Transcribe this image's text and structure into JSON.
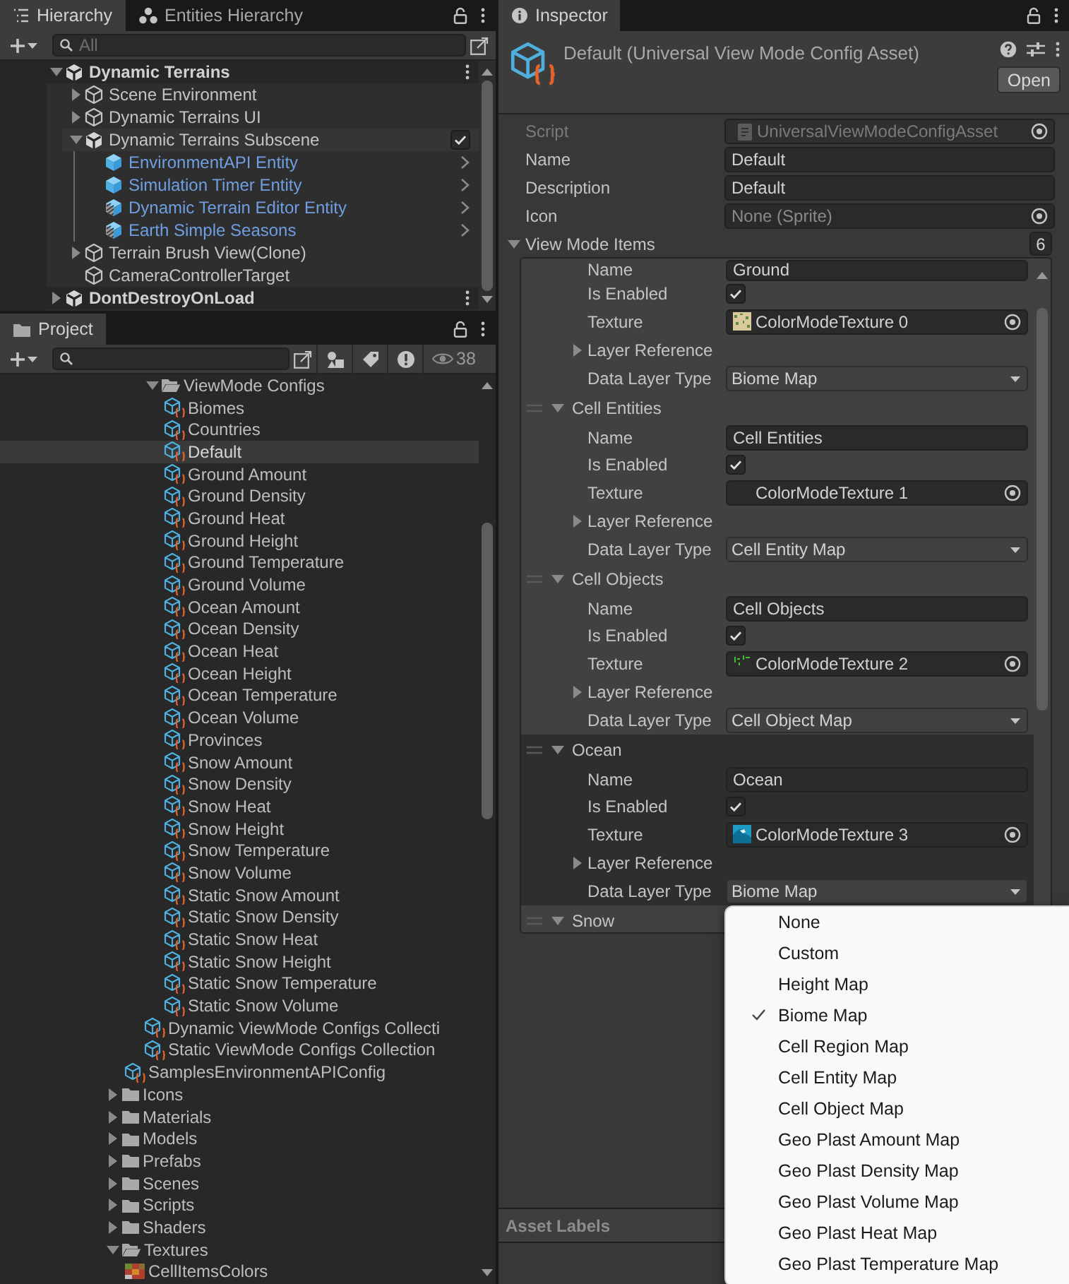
{
  "hierarchy": {
    "tabs": [
      {
        "label": "Hierarchy",
        "kind": "list",
        "selected": true
      },
      {
        "label": "Entities Hierarchy",
        "kind": "entities",
        "selected": false
      }
    ],
    "search": {
      "placeholder": "All"
    },
    "tree": [
      {
        "label": "Dynamic Terrains",
        "kind": "scene",
        "expanded": true,
        "children": [
          {
            "label": "Scene Environment",
            "kind": "object",
            "expanded": false
          },
          {
            "label": "Dynamic Terrains UI",
            "kind": "object",
            "expanded": false
          },
          {
            "label": "Dynamic Terrains Subscene",
            "kind": "subscene",
            "expanded": true,
            "checked": true,
            "children": [
              {
                "label": "EnvironmentAPI Entity",
                "kind": "entity"
              },
              {
                "label": "Simulation Timer Entity",
                "kind": "entity"
              },
              {
                "label": "Dynamic Terrain Editor Entity",
                "kind": "entity-mixed"
              },
              {
                "label": "Earth Simple Seasons",
                "kind": "entity-mixed"
              }
            ]
          },
          {
            "label": "Terrain Brush View(Clone)",
            "kind": "object",
            "expanded": false
          },
          {
            "label": "CameraControllerTarget",
            "kind": "leaf"
          }
        ]
      },
      {
        "label": "DontDestroyOnLoad",
        "kind": "scene",
        "expanded": false
      }
    ]
  },
  "project": {
    "tabs": [
      {
        "label": "Project",
        "kind": "folder",
        "selected": true
      }
    ],
    "hidden_count": "38",
    "tree": {
      "above": {
        "above": {
          "items": [
            {
              "label": "ViewMode Configs",
              "kind": "folder",
              "expanded": true,
              "selected": false,
              "children": [
                {
                  "label": "Biomes",
                  "kind": "config",
                  "selected": false
                },
                {
                  "label": "Countries",
                  "kind": "config",
                  "selected": false
                },
                {
                  "label": "Default",
                  "kind": "config",
                  "selected": true
                },
                {
                  "label": "Ground Amount",
                  "kind": "config",
                  "selected": false
                },
                {
                  "label": "Ground Density",
                  "kind": "config",
                  "selected": false
                },
                {
                  "label": "Ground Heat",
                  "kind": "config",
                  "selected": false
                },
                {
                  "label": "Ground Height",
                  "kind": "config",
                  "selected": false
                },
                {
                  "label": "Ground Temperature",
                  "kind": "config",
                  "selected": false
                },
                {
                  "label": "Ground Volume",
                  "kind": "config",
                  "selected": false
                },
                {
                  "label": "Ocean Amount",
                  "kind": "config",
                  "selected": false
                },
                {
                  "label": "Ocean Density",
                  "kind": "config",
                  "selected": false
                },
                {
                  "label": "Ocean Heat",
                  "kind": "config",
                  "selected": false
                },
                {
                  "label": "Ocean Height",
                  "kind": "config",
                  "selected": false
                },
                {
                  "label": "Ocean Temperature",
                  "kind": "config",
                  "selected": false
                },
                {
                  "label": "Ocean Volume",
                  "kind": "config",
                  "selected": false
                },
                {
                  "label": "Provinces",
                  "kind": "config",
                  "selected": false
                },
                {
                  "label": "Snow Amount",
                  "kind": "config",
                  "selected": false
                },
                {
                  "label": "Snow Density",
                  "kind": "config",
                  "selected": false
                },
                {
                  "label": "Snow Heat",
                  "kind": "config",
                  "selected": false
                },
                {
                  "label": "Snow Height",
                  "kind": "config",
                  "selected": false
                },
                {
                  "label": "Snow Temperature",
                  "kind": "config",
                  "selected": false
                },
                {
                  "label": "Snow Volume",
                  "kind": "config",
                  "selected": false
                },
                {
                  "label": "Static Snow Amount",
                  "kind": "config",
                  "selected": false
                },
                {
                  "label": "Static Snow Density",
                  "kind": "config",
                  "selected": false
                },
                {
                  "label": "Static Snow Heat",
                  "kind": "config",
                  "selected": false
                },
                {
                  "label": "Static Snow Height",
                  "kind": "config",
                  "selected": false
                },
                {
                  "label": "Static Snow Temperature",
                  "kind": "config",
                  "selected": false
                },
                {
                  "label": "Static Snow Volume",
                  "kind": "config",
                  "selected": false
                }
              ]
            },
            {
              "label": "Dynamic ViewMode Configs Collecti",
              "kind": "config",
              "selected": false
            },
            {
              "label": "Static ViewMode Configs Collection",
              "kind": "config",
              "selected": false
            }
          ]
        },
        "items": [
          {
            "label": "SamplesEnvironmentAPIConfig",
            "kind": "config",
            "selected": false
          }
        ]
      },
      "items": [
        {
          "label": "Icons",
          "kind": "folder",
          "expanded": false,
          "selected": false
        },
        {
          "label": "Materials",
          "kind": "folder",
          "expanded": false,
          "selected": false
        },
        {
          "label": "Models",
          "kind": "folder",
          "expanded": false,
          "selected": false
        },
        {
          "label": "Prefabs",
          "kind": "folder",
          "expanded": false,
          "selected": false
        },
        {
          "label": "Scenes",
          "kind": "folder",
          "expanded": false,
          "selected": false
        },
        {
          "label": "Scripts",
          "kind": "folder",
          "expanded": false,
          "selected": false
        },
        {
          "label": "Shaders",
          "kind": "folder",
          "expanded": false,
          "selected": false
        },
        {
          "label": "Textures",
          "kind": "folder",
          "expanded": true,
          "selected": false,
          "children": [
            {
              "label": "CellItemsColors",
              "kind": "texture",
              "selected": false
            }
          ]
        }
      ]
    }
  },
  "inspector": {
    "tabs": [
      {
        "label": "Inspector",
        "kind": "info",
        "selected": true
      }
    ],
    "title": "Default (Universal View Mode Config Asset)",
    "open_button": "Open",
    "properties": [
      {
        "label": "Script",
        "kind": "object",
        "value": "UniversalViewModeConfigAsset",
        "thumbnail": {
          "kind": "script"
        },
        "disabled": true,
        "empty": false
      },
      {
        "label": "Name",
        "kind": "text",
        "value": "Default",
        "disabled": false
      },
      {
        "label": "Description",
        "kind": "text",
        "value": "Default",
        "disabled": false
      },
      {
        "label": "Icon",
        "kind": "object",
        "value": "None (Sprite)",
        "disabled": false,
        "empty": true
      }
    ],
    "list": {
      "label": "View Mode Items",
      "expanded": true,
      "count": "6",
      "elements": [
        {
          "selected": false,
          "fields": [
            {
              "label": "Name",
              "kind": "text",
              "value": "Ground"
            },
            {
              "label": "Is Enabled",
              "kind": "checkbox",
              "checked": true
            },
            {
              "label": "Texture",
              "kind": "object",
              "value": "ColorModeTexture 0",
              "thumbnail": {
                "kind": "sand"
              }
            },
            {
              "label": "Layer Reference",
              "kind": "foldout",
              "expanded": false
            },
            {
              "label": "Data Layer Type",
              "kind": "dropdown",
              "value": "Biome Map"
            }
          ]
        },
        {
          "title": "Cell Entities",
          "expanded": true,
          "selected": false,
          "fields": [
            {
              "label": "Name",
              "kind": "text",
              "value": "Cell Entities"
            },
            {
              "label": "Is Enabled",
              "kind": "checkbox",
              "checked": true
            },
            {
              "label": "Texture",
              "kind": "object",
              "value": "ColorModeTexture 1",
              "thumbnail": {
                "kind": "blank"
              }
            },
            {
              "label": "Layer Reference",
              "kind": "foldout",
              "expanded": false
            },
            {
              "label": "Data Layer Type",
              "kind": "dropdown",
              "value": "Cell Entity Map"
            }
          ]
        },
        {
          "title": "Cell Objects",
          "expanded": true,
          "selected": false,
          "fields": [
            {
              "label": "Name",
              "kind": "text",
              "value": "Cell Objects"
            },
            {
              "label": "Is Enabled",
              "kind": "checkbox",
              "checked": true
            },
            {
              "label": "Texture",
              "kind": "object",
              "value": "ColorModeTexture 2",
              "thumbnail": {
                "kind": "green"
              }
            },
            {
              "label": "Layer Reference",
              "kind": "foldout",
              "expanded": false
            },
            {
              "label": "Data Layer Type",
              "kind": "dropdown",
              "value": "Cell Object Map"
            }
          ]
        },
        {
          "title": "Ocean",
          "expanded": true,
          "selected": true,
          "fields": [
            {
              "label": "Name",
              "kind": "text",
              "value": "Ocean"
            },
            {
              "label": "Is Enabled",
              "kind": "checkbox",
              "checked": true
            },
            {
              "label": "Texture",
              "kind": "object",
              "value": "ColorModeTexture 3",
              "thumbnail": {
                "kind": "wave"
              }
            },
            {
              "label": "Layer Reference",
              "kind": "foldout",
              "expanded": false
            },
            {
              "label": "Data Layer Type",
              "kind": "dropdown",
              "value": "Biome Map"
            }
          ]
        },
        {
          "title": "Snow",
          "expanded": true,
          "selected": false
        }
      ]
    },
    "asset_labels": "Asset Labels"
  },
  "popup": {
    "options": [
      {
        "label": "None",
        "selected": false
      },
      {
        "label": "Custom",
        "selected": false
      },
      {
        "label": "Height Map",
        "selected": false
      },
      {
        "label": "Biome Map",
        "selected": true
      },
      {
        "label": "Cell Region Map",
        "selected": false
      },
      {
        "label": "Cell Entity Map",
        "selected": false
      },
      {
        "label": "Cell Object Map",
        "selected": false
      },
      {
        "label": "Geo Plast Amount Map",
        "selected": false
      },
      {
        "label": "Geo Plast Density Map",
        "selected": false
      },
      {
        "label": "Geo Plast Volume Map",
        "selected": false
      },
      {
        "label": "Geo Plast Heat Map",
        "selected": false
      },
      {
        "label": "Geo Plast Temperature Map",
        "selected": false
      }
    ]
  }
}
